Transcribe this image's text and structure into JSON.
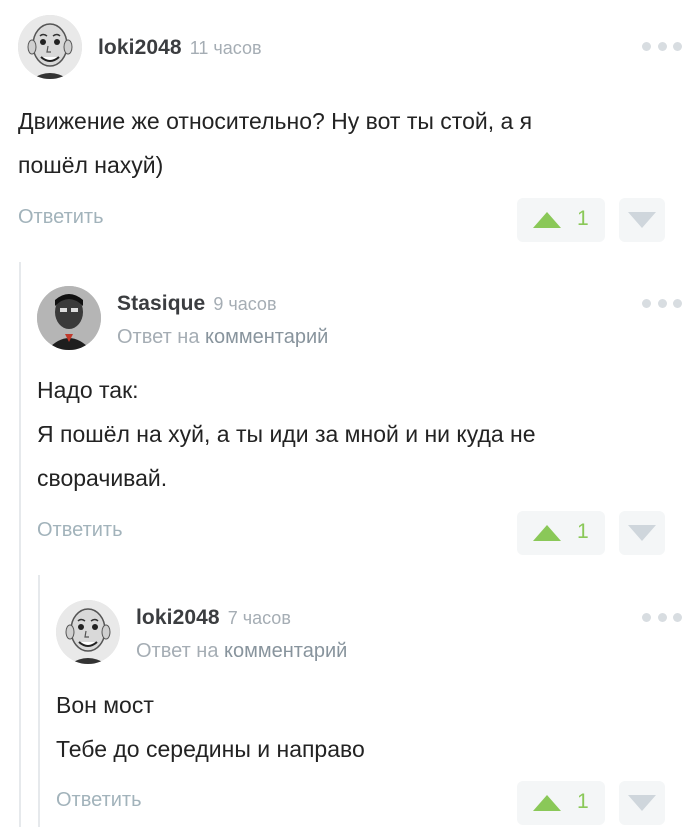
{
  "comments": [
    {
      "username": "loki2048",
      "time": "11 часов",
      "reply_prefix": "",
      "reply_link": "",
      "lines": [
        "Движение же относительно? Ну вот ты стой, а я",
        "пошёл нахуй)"
      ],
      "reply_label": "Ответить",
      "votes": "1",
      "avatar_icon": "bald-man-avatar-icon"
    },
    {
      "username": "Stasique",
      "time": "9 часов",
      "reply_prefix": "Ответ на",
      "reply_link": "комментарий",
      "lines": [
        "Надо так:",
        "Я пошёл на хуй, а ты иди за мной и ни куда не",
        "сворачивай."
      ],
      "reply_label": "Ответить",
      "votes": "1",
      "avatar_icon": "dark-figure-avatar-icon"
    },
    {
      "username": "loki2048",
      "time": "7 часов",
      "reply_prefix": "Ответ на",
      "reply_link": "комментарий",
      "lines": [
        "Вон мост",
        "Тебе до середины и направо"
      ],
      "reply_label": "Ответить",
      "votes": "1",
      "avatar_icon": "bald-man-avatar-icon"
    }
  ],
  "colors": {
    "vote_up": "#8ac858",
    "vote_down": "#cfd6dc",
    "muted": "#a5adb4",
    "reply_action": "#a2b3bb"
  }
}
